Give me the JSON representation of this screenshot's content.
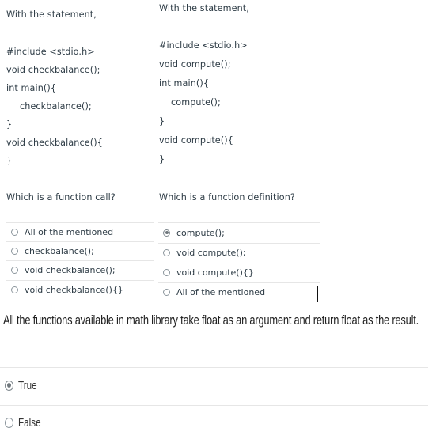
{
  "question1": {
    "intro": "With the statement,",
    "code": [
      "#include <stdio.h>",
      "void checkbalance();",
      "int main(){",
      "checkbalance();",
      "}",
      "void checkbalance(){",
      "}"
    ],
    "prompt": "Which is a function call?",
    "options": [
      {
        "label": "All of the mentioned",
        "selected": false
      },
      {
        "label": "checkbalance();",
        "selected": false
      },
      {
        "label": "void checkbalance();",
        "selected": false
      },
      {
        "label": "void checkbalance(){}",
        "selected": false
      }
    ]
  },
  "question2": {
    "intro": "With the statement,",
    "code": [
      "#include <stdio.h>",
      "void compute();",
      "int main(){",
      "compute();",
      "}",
      "void compute(){",
      "}"
    ],
    "prompt": "Which is a function definition?",
    "options": [
      {
        "label": "compute();",
        "selected": true
      },
      {
        "label": "void compute();",
        "selected": false
      },
      {
        "label": "void compute(){}",
        "selected": false
      },
      {
        "label": "All of the mentioned",
        "selected": false
      }
    ]
  },
  "question3": {
    "prompt": "All the functions available in math library take float as an argument and return float as the result.",
    "options": [
      {
        "label": "True",
        "selected": true
      },
      {
        "label": "False",
        "selected": false
      }
    ]
  }
}
